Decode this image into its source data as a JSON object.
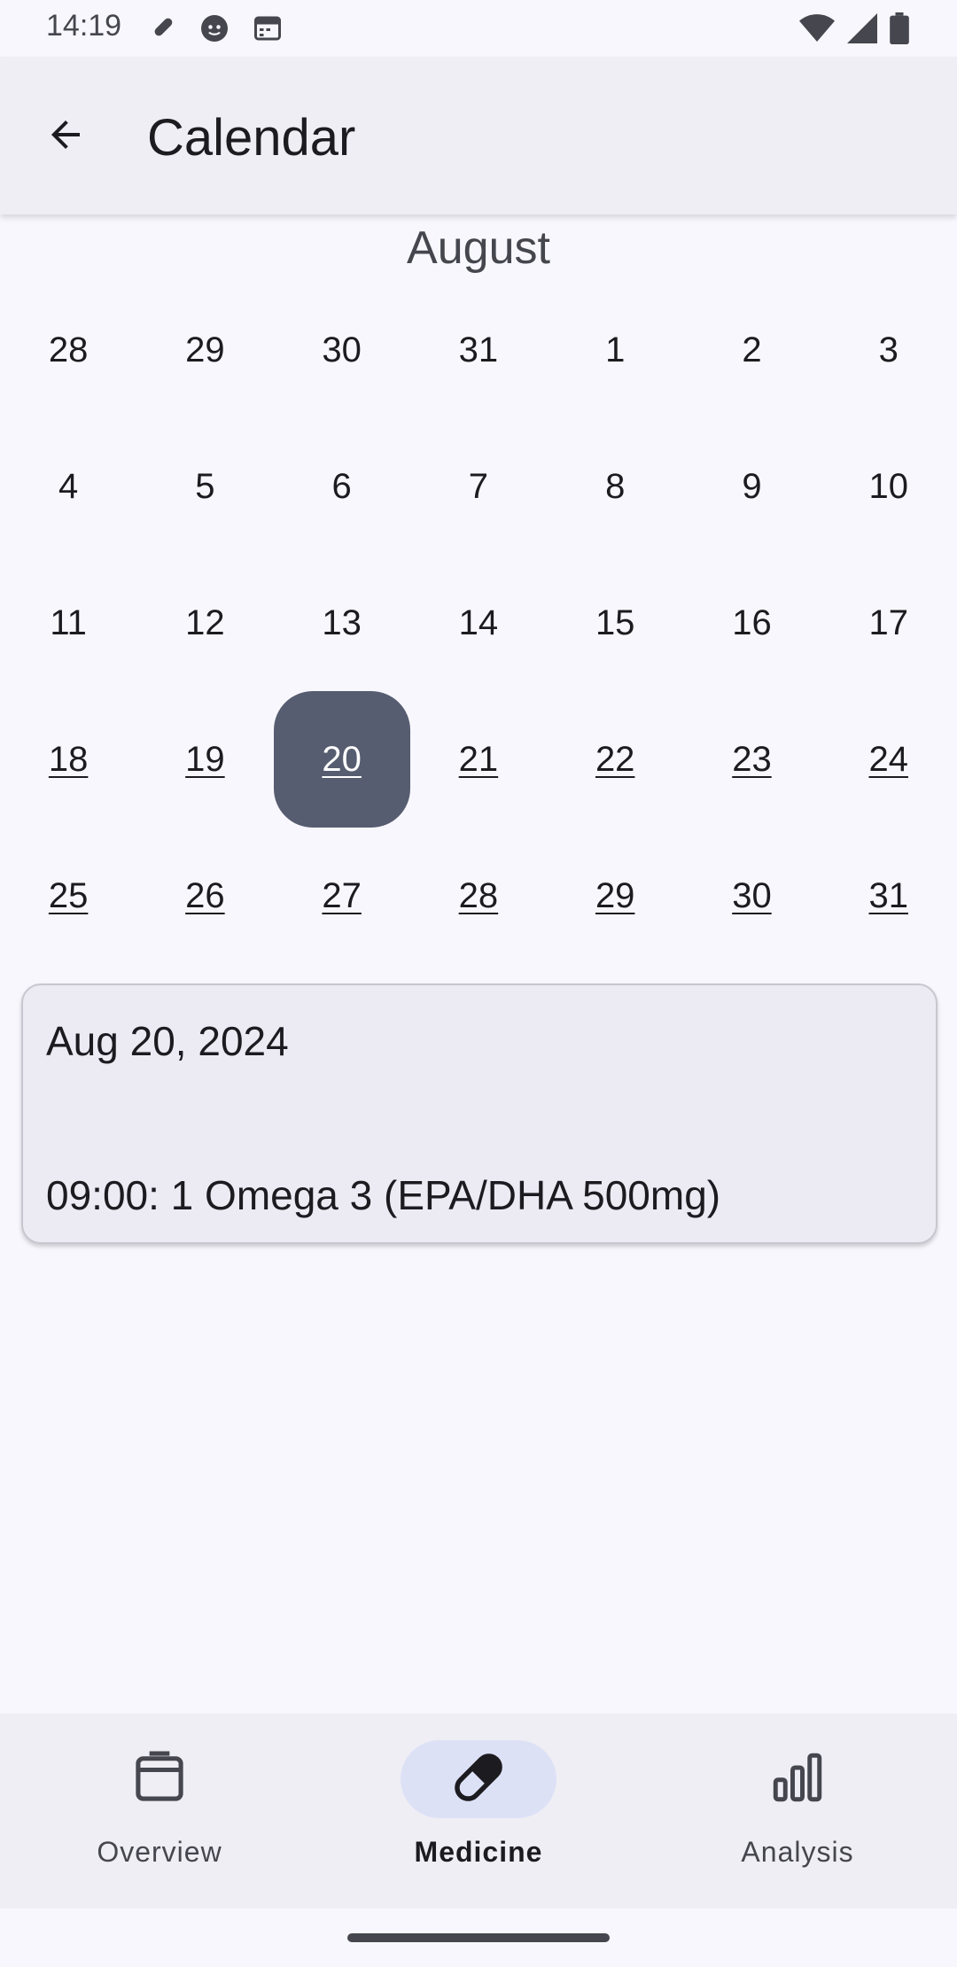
{
  "status_bar": {
    "time": "14:19",
    "left_icons": [
      "pill-icon",
      "smiley-icon",
      "calendar-icon"
    ],
    "right_icons": [
      "wifi-icon",
      "signal-icon",
      "battery-icon"
    ]
  },
  "app_bar": {
    "title": "Calendar",
    "back_icon": "arrow-back-icon"
  },
  "calendar": {
    "month": "August",
    "weeks": [
      [
        {
          "d": "28",
          "entry": false
        },
        {
          "d": "29",
          "entry": false
        },
        {
          "d": "30",
          "entry": false
        },
        {
          "d": "31",
          "entry": false
        },
        {
          "d": "1",
          "entry": false
        },
        {
          "d": "2",
          "entry": false
        },
        {
          "d": "3",
          "entry": false
        }
      ],
      [
        {
          "d": "4",
          "entry": false
        },
        {
          "d": "5",
          "entry": false
        },
        {
          "d": "6",
          "entry": false
        },
        {
          "d": "7",
          "entry": false
        },
        {
          "d": "8",
          "entry": false
        },
        {
          "d": "9",
          "entry": false
        },
        {
          "d": "10",
          "entry": false
        }
      ],
      [
        {
          "d": "11",
          "entry": false
        },
        {
          "d": "12",
          "entry": false
        },
        {
          "d": "13",
          "entry": false
        },
        {
          "d": "14",
          "entry": false
        },
        {
          "d": "15",
          "entry": false
        },
        {
          "d": "16",
          "entry": false
        },
        {
          "d": "17",
          "entry": false
        }
      ],
      [
        {
          "d": "18",
          "entry": true
        },
        {
          "d": "19",
          "entry": true
        },
        {
          "d": "20",
          "entry": true,
          "selected": true
        },
        {
          "d": "21",
          "entry": true
        },
        {
          "d": "22",
          "entry": true
        },
        {
          "d": "23",
          "entry": true
        },
        {
          "d": "24",
          "entry": true
        }
      ],
      [
        {
          "d": "25",
          "entry": true
        },
        {
          "d": "26",
          "entry": true
        },
        {
          "d": "27",
          "entry": true
        },
        {
          "d": "28",
          "entry": true
        },
        {
          "d": "29",
          "entry": true
        },
        {
          "d": "30",
          "entry": true
        },
        {
          "d": "31",
          "entry": true
        }
      ]
    ],
    "selected_color": "#575d70"
  },
  "detail": {
    "date": "Aug 20, 2024",
    "entries": [
      "09:00: 1 Omega 3 (EPA/DHA 500mg)"
    ]
  },
  "bottom_nav": {
    "items": [
      {
        "label": "Overview",
        "icon": "calendar-icon",
        "active": false
      },
      {
        "label": "Medicine",
        "icon": "pill-icon",
        "active": true
      },
      {
        "label": "Analysis",
        "icon": "bar-chart-icon",
        "active": false
      }
    ],
    "active_indicator_color": "#dde1f6"
  }
}
